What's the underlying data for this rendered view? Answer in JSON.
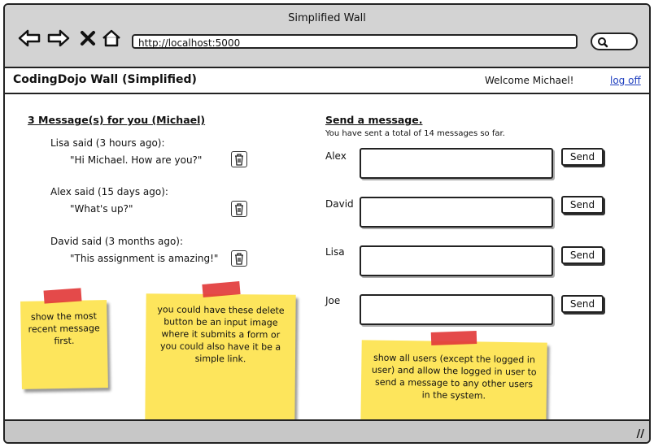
{
  "window": {
    "title": "Simplified Wall",
    "url": "http://localhost:5000"
  },
  "icons": {
    "back": "arrow-left-icon",
    "forward": "arrow-right-icon",
    "close": "close-x-icon",
    "home": "home-icon",
    "search": "search-icon",
    "trash": "trash-icon",
    "resize": "resize-grip-icon"
  },
  "header": {
    "title": "CodingDojo Wall (Simplified)",
    "welcome": "Welcome Michael!",
    "logoff": "log off"
  },
  "inbox": {
    "heading": "3 Message(s) for you (Michael)",
    "messages": [
      {
        "said": "Lisa said (3 hours ago):",
        "text": "\"Hi Michael.  How are you?\""
      },
      {
        "said": "Alex said (15 days ago):",
        "text": "\"What's up?\""
      },
      {
        "said": "David said (3 months ago):",
        "text": "\"This assignment is amazing!\""
      }
    ]
  },
  "send": {
    "heading": "Send a message.",
    "subtitle": "You have sent a total of 14 messages so far.",
    "button_label": "Send",
    "users": [
      "Alex",
      "David",
      "Lisa",
      "Joe"
    ]
  },
  "notes": [
    {
      "text": "show the most recent message first."
    },
    {
      "text": "you could have these delete button be an input image where it submits a form or you could also have it be a simple link."
    },
    {
      "text": "show all users (except the logged in user) and allow the logged in user to send a message to any other users in the system."
    }
  ],
  "colors": {
    "chrome": "#d3d3d3",
    "sticky": "#fde55c",
    "tape": "#e23b3b",
    "link": "#1f3fbf"
  }
}
